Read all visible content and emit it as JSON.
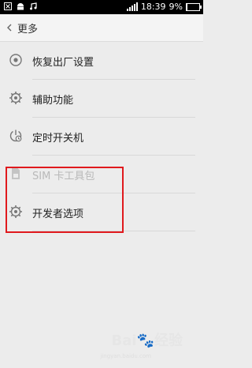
{
  "status_bar": {
    "time": "18:39",
    "battery": "9%",
    "battery_level": 0.09
  },
  "header": {
    "back_icon": "chevron-left-icon",
    "title": "更多"
  },
  "list": [
    {
      "icon": "restore-icon",
      "label": "恢复出厂设置",
      "enabled": true
    },
    {
      "icon": "accessibility-gear-icon",
      "label": "辅助功能",
      "enabled": true
    },
    {
      "icon": "power-clock-icon",
      "label": "定时开关机",
      "enabled": true
    },
    {
      "icon": "sim-card-icon",
      "label": "SIM 卡工具包",
      "enabled": false
    },
    {
      "icon": "developer-gear-icon",
      "label": "开发者选项",
      "enabled": true
    }
  ],
  "highlight_color": "#e0191d",
  "watermark": {
    "text": "Bai🐾经验",
    "sub": "jingyan.baidu.com"
  }
}
